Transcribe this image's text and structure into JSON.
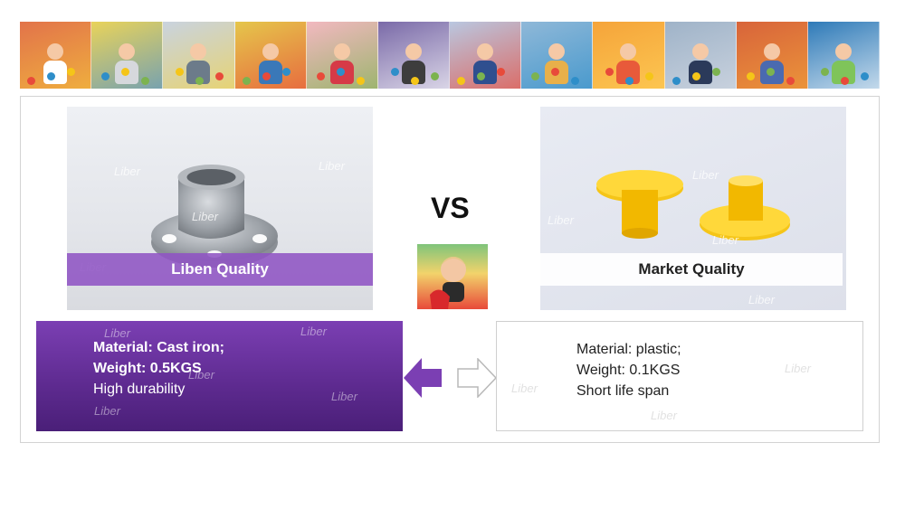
{
  "banner": {
    "tiles": [
      {
        "bg": "#e2734a",
        "shirt": "#ffffff",
        "accent": "#f4c53a"
      },
      {
        "bg": "#e9d35a",
        "shirt": "#d6d8dc",
        "accent": "#4b8fd0"
      },
      {
        "bg": "#c9d3df",
        "shirt": "#6c7b8a",
        "accent": "#f2d34a"
      },
      {
        "bg": "#e5c64b",
        "shirt": "#3a78b8",
        "accent": "#e84a3a"
      },
      {
        "bg": "#f2b8c0",
        "shirt": "#d63a47",
        "accent": "#7cb34f"
      },
      {
        "bg": "#7a6aa8",
        "shirt": "#3d3d3d",
        "accent": "#ffffff"
      },
      {
        "bg": "#b9c7e0",
        "shirt": "#2f4f8f",
        "accent": "#e84a3a"
      },
      {
        "bg": "#8fb8d8",
        "shirt": "#e8b04a",
        "accent": "#2e8ec9"
      },
      {
        "bg": "#f5a43a",
        "shirt": "#e85a3a",
        "accent": "#ffd35a"
      },
      {
        "bg": "#9fb3c8",
        "shirt": "#2b3a5a",
        "accent": "#d8dde6"
      },
      {
        "bg": "#d8643a",
        "shirt": "#4a6ab0",
        "accent": "#f2a63a"
      },
      {
        "bg": "#2e7ab8",
        "shirt": "#7fc45a",
        "accent": "#ffffff"
      }
    ]
  },
  "left_photo": {
    "label": "Liben Quality"
  },
  "right_photo": {
    "label": "Market Quality"
  },
  "vs_text": "VS",
  "watermark": "Liber",
  "liben_box": {
    "line1": "Material:  Cast iron;",
    "line2": "Weight: 0.5KGS",
    "line3": "High durability"
  },
  "market_box": {
    "line1": "Material:  plastic;",
    "line2": "Weight: 0.1KGS",
    "line3": "Short life span"
  },
  "colors": {
    "liben_purple": "#6a34a0",
    "arrow_purple": "#7b3fb3",
    "yellow_part": "#f5c518"
  }
}
